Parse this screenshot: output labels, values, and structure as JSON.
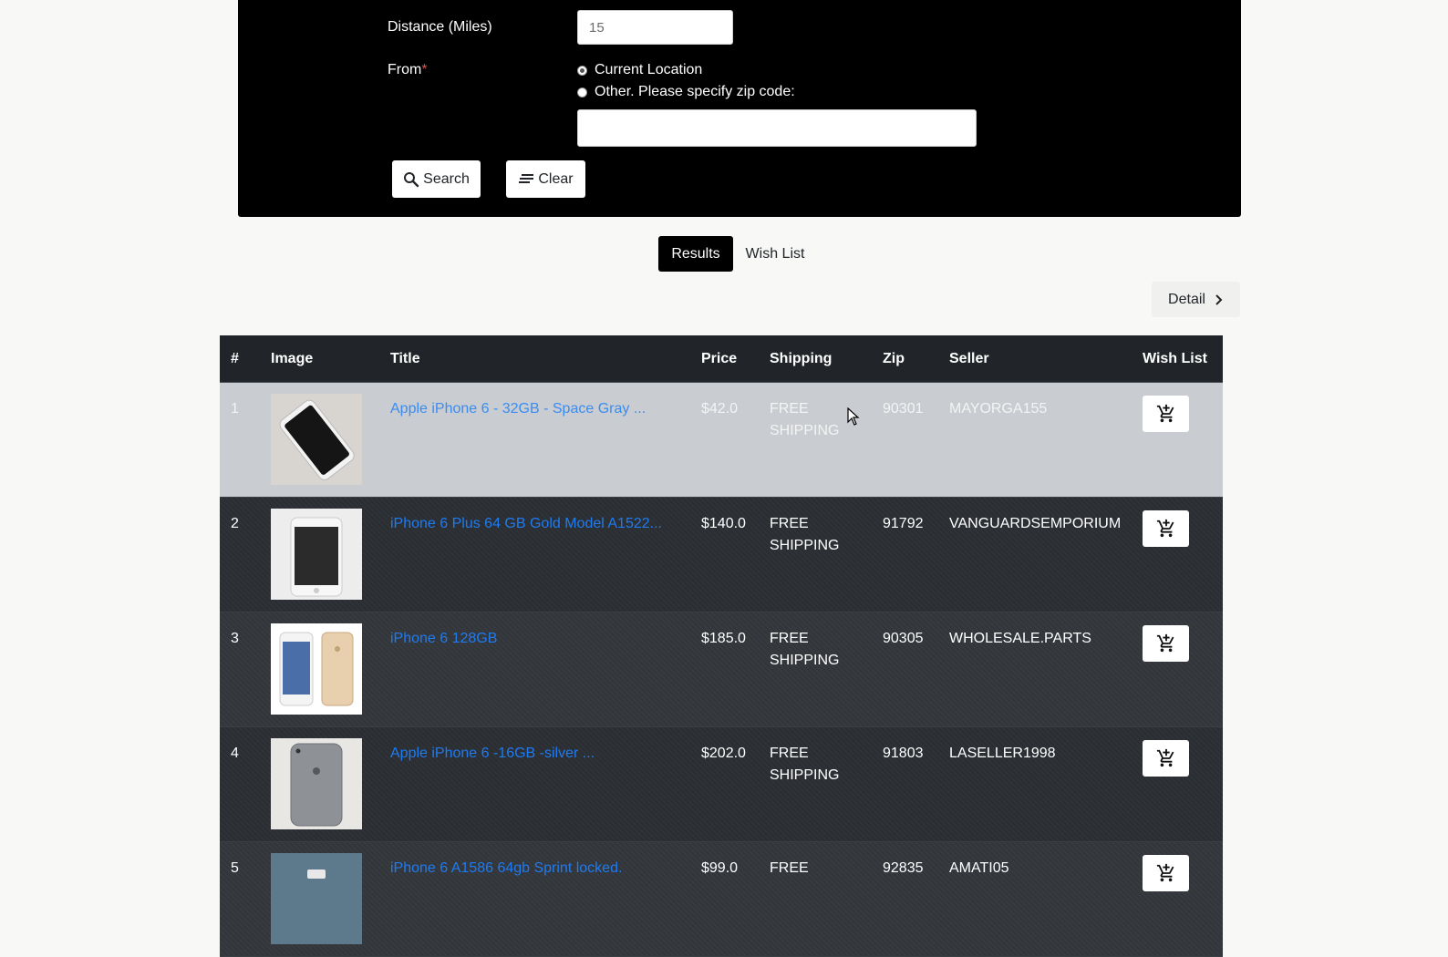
{
  "form": {
    "distance_label": "Distance (Miles)",
    "distance_value": "15",
    "from_label": "From",
    "required_mark": "*",
    "radio_current": "Current Location",
    "radio_other": "Other. Please specify zip code:",
    "zip_value": "",
    "search_label": "Search",
    "clear_label": "Clear"
  },
  "tabs": {
    "results": "Results",
    "wishlist": "Wish List"
  },
  "detail_label": "Detail",
  "table": {
    "headers": {
      "num": "#",
      "image": "Image",
      "title": "Title",
      "price": "Price",
      "shipping": "Shipping",
      "zip": "Zip",
      "seller": "Seller",
      "wish": "Wish List"
    },
    "rows": [
      {
        "num": "1",
        "title": "Apple iPhone 6 - 32GB - Space Gray ...",
        "price": "$42.0",
        "ship1": "FREE",
        "ship2": "SHIPPING",
        "zip": "90301",
        "seller": "MAYORGA155"
      },
      {
        "num": "2",
        "title": "iPhone 6 Plus 64 GB Gold Model A1522...",
        "price": "$140.0",
        "ship1": "FREE",
        "ship2": "SHIPPING",
        "zip": "91792",
        "seller": "VANGUARDSEMPORIUM"
      },
      {
        "num": "3",
        "title": "iPhone 6 128GB",
        "price": "$185.0",
        "ship1": "FREE",
        "ship2": "SHIPPING",
        "zip": "90305",
        "seller": "WHOLESALE.PARTS"
      },
      {
        "num": "4",
        "title": "Apple iPhone 6 -16GB -silver ...",
        "price": "$202.0",
        "ship1": "FREE",
        "ship2": "SHIPPING",
        "zip": "91803",
        "seller": "LASELLER1998"
      },
      {
        "num": "5",
        "title": "iPhone 6 A1586 64gb Sprint locked.",
        "price": "$99.0",
        "ship1": "FREE",
        "ship2": "",
        "zip": "92835",
        "seller": "AMATI05"
      }
    ]
  },
  "colors": {
    "link": "#1e7bf0",
    "table_bg": "#2a2e33",
    "header_bg": "#212529",
    "hover_row": "#c9ccd0"
  }
}
